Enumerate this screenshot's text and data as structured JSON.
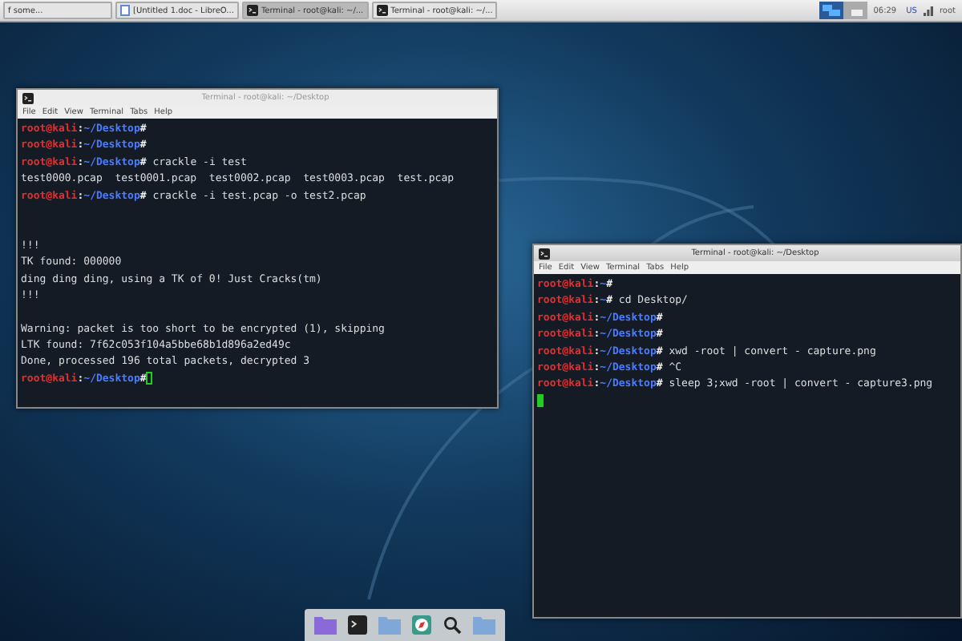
{
  "panel": {
    "tasks": [
      {
        "label": "f some...",
        "selected": false,
        "kind": "plain"
      },
      {
        "label": "[Untitled 1.doc - LibreO...",
        "selected": false,
        "kind": "document"
      },
      {
        "label": "Terminal - root@kali: ~/...",
        "selected": true,
        "kind": "terminal"
      },
      {
        "label": "Terminal - root@kali: ~/...",
        "selected": false,
        "kind": "terminal"
      }
    ],
    "clock": "06:29",
    "keyboard": "US",
    "user": "root"
  },
  "terminals": [
    {
      "title": "Terminal - root@kali: ~/Desktop",
      "focused": false,
      "menu": [
        "File",
        "Edit",
        "View",
        "Terminal",
        "Tabs",
        "Help"
      ],
      "lines": [
        {
          "kind": "prompt",
          "user": "root@kali",
          "sep": ":",
          "path": "~/Desktop",
          "end": "#"
        },
        {
          "kind": "prompt",
          "user": "root@kali",
          "sep": ":",
          "path": "~/Desktop",
          "end": "#"
        },
        {
          "kind": "prompt",
          "user": "root@kali",
          "sep": ":",
          "path": "~/Desktop",
          "end": "#",
          "command": " crackle -i test"
        },
        {
          "kind": "output",
          "text": "test0000.pcap  test0001.pcap  test0002.pcap  test0003.pcap  test.pcap"
        },
        {
          "kind": "prompt",
          "user": "root@kali",
          "sep": ":",
          "path": "~/Desktop",
          "end": "#",
          "command": " crackle -i test.pcap -o test2.pcap"
        },
        {
          "kind": "blank"
        },
        {
          "kind": "blank"
        },
        {
          "kind": "output",
          "text": "!!!"
        },
        {
          "kind": "output",
          "text": "TK found: 000000"
        },
        {
          "kind": "output",
          "text": "ding ding ding, using a TK of 0! Just Cracks(tm)"
        },
        {
          "kind": "output",
          "text": "!!!"
        },
        {
          "kind": "blank"
        },
        {
          "kind": "output",
          "text": "Warning: packet is too short to be encrypted (1), skipping"
        },
        {
          "kind": "output",
          "text": "LTK found: 7f62c053f104a5bbe68b1d896a2ed49c"
        },
        {
          "kind": "output",
          "text": "Done, processed 196 total packets, decrypted 3"
        },
        {
          "kind": "prompt",
          "user": "root@kali",
          "sep": ":",
          "path": "~/Desktop",
          "end": "#",
          "cursor": true
        }
      ]
    },
    {
      "title": "Terminal - root@kali: ~/Desktop",
      "focused": true,
      "menu": [
        "File",
        "Edit",
        "View",
        "Terminal",
        "Tabs",
        "Help"
      ],
      "lines": [
        {
          "kind": "prompt",
          "user": "root@kali",
          "sep": ":",
          "path": "~",
          "end": "#"
        },
        {
          "kind": "prompt",
          "user": "root@kali",
          "sep": ":",
          "path": "~",
          "end": "#",
          "command": " cd Desktop/"
        },
        {
          "kind": "prompt",
          "user": "root@kali",
          "sep": ":",
          "path": "~/Desktop",
          "end": "#"
        },
        {
          "kind": "prompt",
          "user": "root@kali",
          "sep": ":",
          "path": "~/Desktop",
          "end": "#"
        },
        {
          "kind": "prompt",
          "user": "root@kali",
          "sep": ":",
          "path": "~/Desktop",
          "end": "#",
          "command": " xwd -root | convert - capture.png"
        },
        {
          "kind": "prompt",
          "user": "root@kali",
          "sep": ":",
          "path": "~/Desktop",
          "end": "#",
          "command": " ^C"
        },
        {
          "kind": "prompt",
          "user": "root@kali",
          "sep": ":",
          "path": "~/Desktop",
          "end": "#",
          "command": " sleep 3;xwd -root | convert - capture3.png"
        },
        {
          "kind": "cursor",
          "cursor": true
        }
      ]
    }
  ]
}
